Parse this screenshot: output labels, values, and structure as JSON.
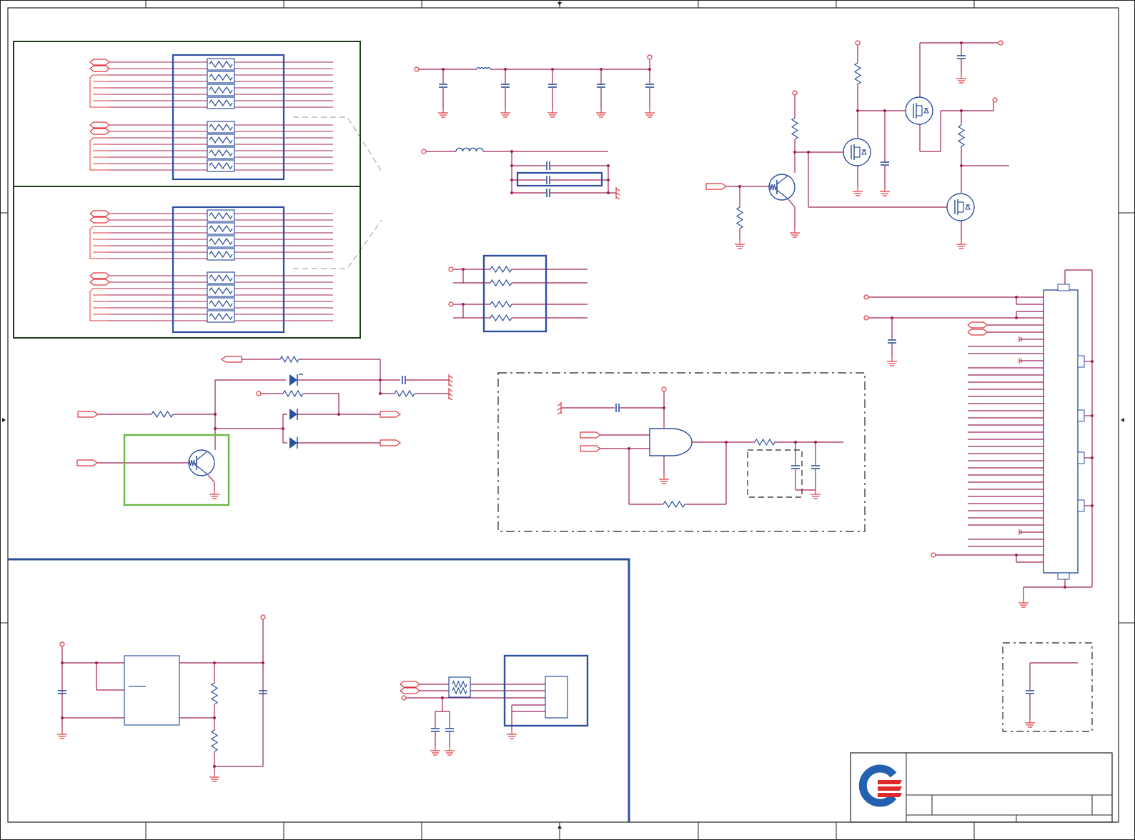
{
  "colors": {
    "wire": "#a0205a",
    "net_red": "#e0353a",
    "component": "#2a4fa0",
    "frame": "#222222",
    "dark_green": "#1f3d1a",
    "light_green": "#6ab845",
    "blue_frame": "#2e4ea2",
    "dash": "#222222",
    "logo_blue": "#2360b0",
    "logo_red": "#e02a2a"
  },
  "icons": {
    "logo": "company-logo-icon",
    "ground": "ground-symbol-icon",
    "chassis_ground": "chassis-ground-icon",
    "transistor": "transistor-icon",
    "mosfet": "mosfet-icon",
    "diode": "diode-icon",
    "and_gate": "and-gate-icon",
    "connector": "connector-icon"
  },
  "title_block": {
    "title": "",
    "size": "",
    "document_number": "",
    "rev": "",
    "date": "",
    "sheet": ""
  }
}
